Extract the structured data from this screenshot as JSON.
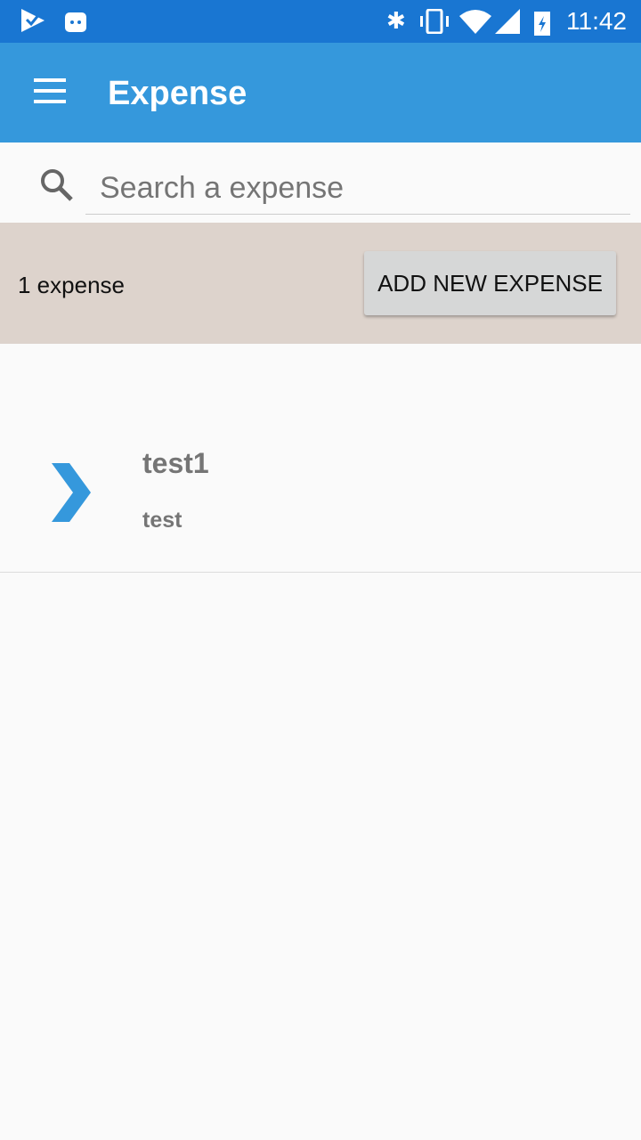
{
  "status_bar": {
    "time": "11:42"
  },
  "app_bar": {
    "title": "Expense"
  },
  "search": {
    "placeholder": "Search a expense",
    "value": ""
  },
  "summary": {
    "count_label": "1 expense",
    "add_button": "ADD NEW EXPENSE"
  },
  "expenses": [
    {
      "name": "test1",
      "description": "test"
    }
  ],
  "colors": {
    "accent": "#3598dc",
    "status": "#1976d2"
  }
}
